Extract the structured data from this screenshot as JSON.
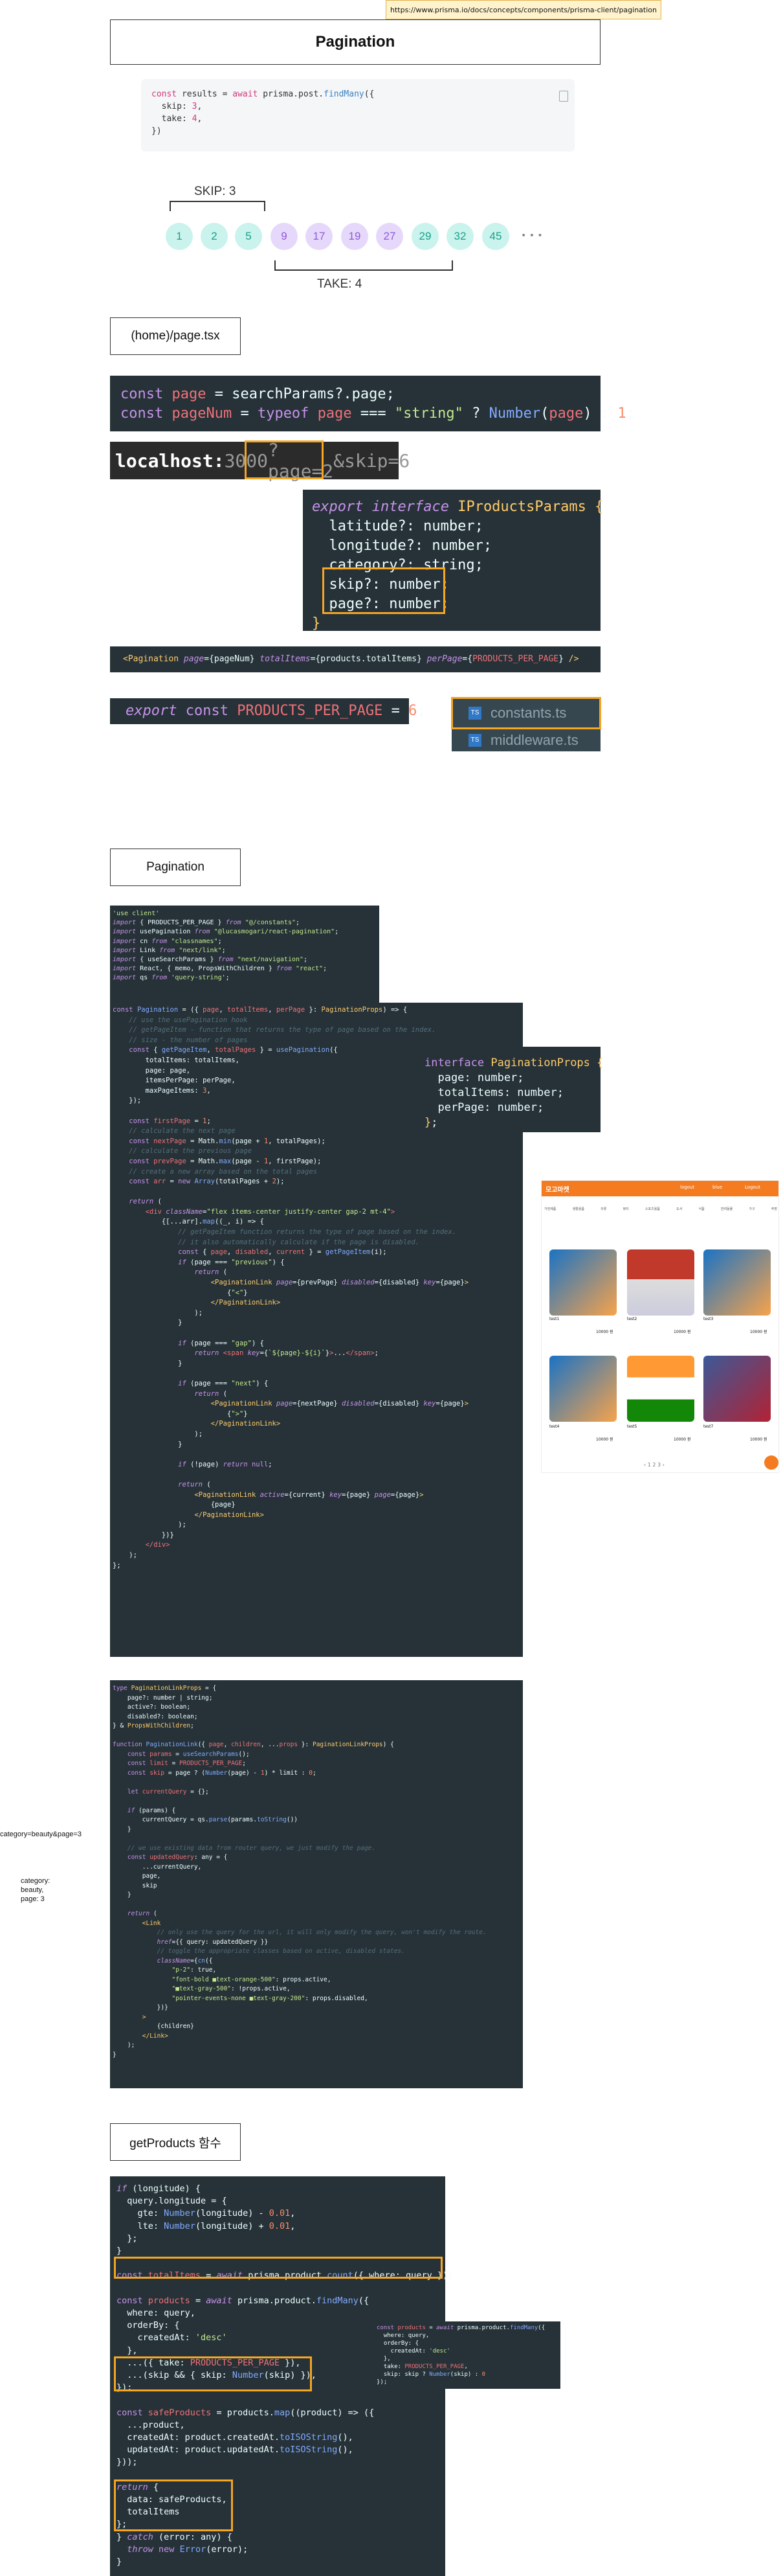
{
  "url_bar": "https://www.prisma.io/docs/concepts/components/prisma-client/pagination",
  "sections": {
    "pagination_title": "Pagination",
    "page_tsx": "(home)/page.tsx",
    "pagination_title2": "Pagination",
    "get_products": "getProducts 함수"
  },
  "diagram": {
    "skip_label": "SKIP: 3",
    "take_label": "TAKE: 4",
    "skip_nums": [
      "1",
      "2",
      "5"
    ],
    "take_nums": [
      "9",
      "17",
      "19",
      "27"
    ],
    "rest_nums": [
      "29",
      "32",
      "45"
    ],
    "more": "• • •"
  },
  "urlbar2": {
    "host": "localhost:",
    "port": "3000",
    "query": "?page=2",
    "rest": "&skip=6"
  },
  "files": [
    "constants.ts",
    "middleware.ts"
  ],
  "side_text": {
    "query": "category=beauty&page=3",
    "obj": [
      "category:",
      "beauty,",
      "page: 3"
    ]
  },
  "colors": {
    "accent": "#f5a623",
    "code_bg": "#263238",
    "teal": "#c9f3ec",
    "purple": "#e6d8fb",
    "brand_orange": "#f47b20"
  },
  "shop": {
    "brand": "모고마켓",
    "nav": [
      "logout",
      "blue",
      "Logout"
    ],
    "categories": [
      "가전제품",
      "생활용품",
      "의류",
      "뷰티",
      "스포츠용품",
      "도서",
      "식품",
      "반려동물",
      "가구",
      "주방"
    ],
    "items": [
      {
        "name": "test1",
        "price": "10000 원"
      },
      {
        "name": "test2",
        "price": "10000 원"
      },
      {
        "name": "test3",
        "price": "10000 원"
      },
      {
        "name": "test4",
        "price": "10000 원"
      },
      {
        "name": "test5",
        "price": "10000 원"
      },
      {
        "name": "test7",
        "price": "10000 원"
      }
    ],
    "pager": "‹ 1 2 3 ›"
  }
}
